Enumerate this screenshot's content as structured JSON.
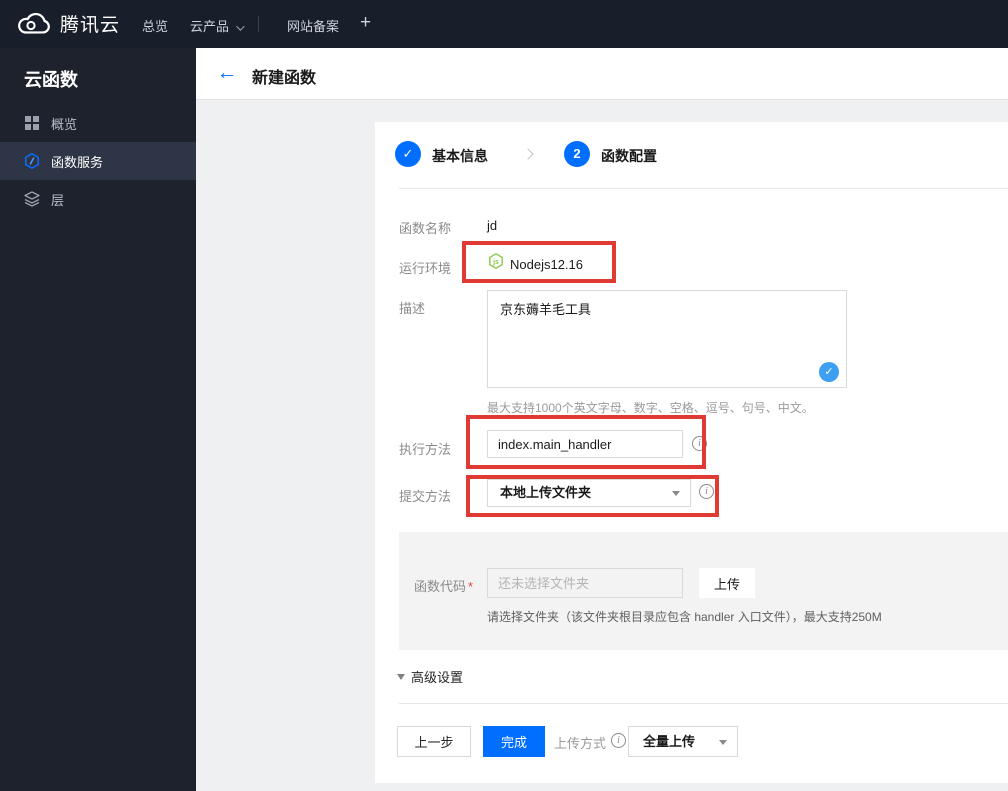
{
  "topbar": {
    "brand": "腾讯云",
    "nav_overview": "总览",
    "nav_products": "云产品",
    "nav_beian": "网站备案",
    "nav_plus": "+"
  },
  "sidebar": {
    "title": "云函数",
    "items": [
      {
        "label": "概览",
        "icon": "grid-icon",
        "active": false
      },
      {
        "label": "函数服务",
        "icon": "scf-hexagon-icon",
        "active": true
      },
      {
        "label": "层",
        "icon": "layers-icon",
        "active": false
      }
    ]
  },
  "header": {
    "back_icon": "←",
    "title": "新建函数"
  },
  "steps": {
    "step1_icon": "✓",
    "step1_label": "基本信息",
    "step2_number": "2",
    "step2_label": "函数配置"
  },
  "form": {
    "name_label": "函数名称",
    "name_value": "jd",
    "runtime_label": "运行环境",
    "runtime_value": "Nodejs12.16",
    "desc_label": "描述",
    "desc_value": "京东薅羊毛工具",
    "desc_check_icon": "✓",
    "desc_hint": "最大支持1000个英文字母、数字、空格、逗号、句号、中文。",
    "handler_label": "执行方法",
    "handler_value": "index.main_handler",
    "handler_info_icon": "i",
    "submit_label": "提交方法",
    "submit_value": "本地上传文件夹",
    "submit_info_icon": "i",
    "code_label": "函数代码",
    "code_required": "*",
    "code_placeholder": "还未选择文件夹",
    "code_upload_button": "上传",
    "code_hint": "请选择文件夹（该文件夹根目录应包含 handler 入口文件），最大支持250M"
  },
  "advanced_label": "高级设置",
  "footer": {
    "prev": "上一步",
    "finish": "完成",
    "upload_mode_label": "上传方式",
    "upload_mode_info_icon": "i",
    "upload_mode_value": "全量上传"
  },
  "colors": {
    "accent_blue": "#006eff",
    "annotation_red": "#df3a34",
    "nodejs_green": "#8cc84b",
    "check_badge_blue": "#3d9ff0",
    "topbar_bg": "#181e2a",
    "sidebar_bg": "#1d222d",
    "sidebar_active_bg": "#2d3546"
  }
}
